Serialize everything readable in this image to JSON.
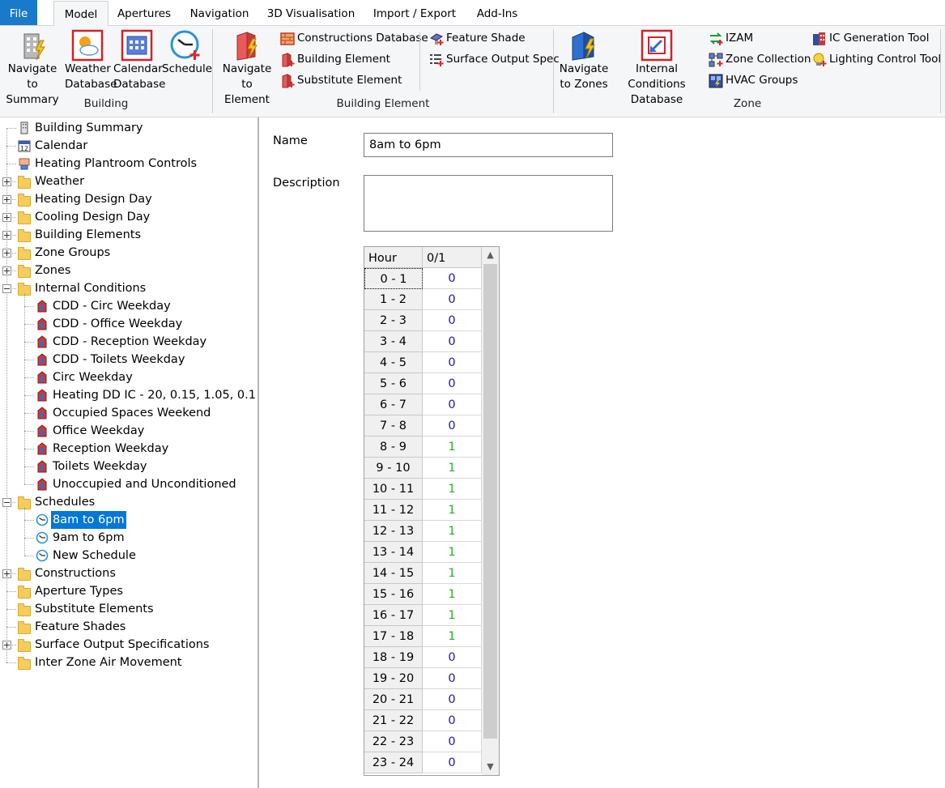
{
  "tabs": [
    "File",
    "Model",
    "Apertures",
    "Navigation",
    "3D Visualisation",
    "Import / Export",
    "Add-Ins"
  ],
  "ribbon": {
    "building": {
      "group_label": "Building",
      "nav_summary": [
        "Navigate to",
        "Summary"
      ],
      "weather_db": [
        "Weather",
        "Database"
      ],
      "calendar_db": [
        "Calendar",
        "Database"
      ],
      "schedule": "Schedule"
    },
    "building_element": {
      "group_label": "Building Element",
      "nav_element": [
        "Navigate",
        "to Element"
      ],
      "constructions_db": "Constructions Database",
      "building_element": "Building Element",
      "substitute_element": "Substitute Element",
      "feature_shade": "Feature Shade",
      "surface_output_spec": "Surface Output Spec"
    },
    "zone": {
      "group_label": "Zone",
      "nav_zones": [
        "Navigate",
        "to Zones"
      ],
      "ic_db": [
        "Internal Conditions",
        "Database"
      ],
      "izam": "IZAM",
      "zone_collection": "Zone Collection",
      "hvac_groups": "HVAC Groups",
      "ic_generation_tool": "IC Generation Tool",
      "lighting_control_tool": "Lighting Control Tool"
    }
  },
  "tree": [
    {
      "label": "Building Summary",
      "icon": "building-icon",
      "level": 0,
      "expander": ""
    },
    {
      "label": "Calendar",
      "icon": "calendar-icon",
      "level": 0,
      "expander": ""
    },
    {
      "label": "Heating Plantroom Controls",
      "icon": "plantroom-icon",
      "level": 0,
      "expander": ""
    },
    {
      "label": "Weather",
      "icon": "folder-icon",
      "level": 0,
      "expander": "plus"
    },
    {
      "label": "Heating Design Day",
      "icon": "folder-icon",
      "level": 0,
      "expander": "plus"
    },
    {
      "label": "Cooling Design Day",
      "icon": "folder-icon",
      "level": 0,
      "expander": "plus"
    },
    {
      "label": "Building Elements",
      "icon": "folder-icon",
      "level": 0,
      "expander": "plus"
    },
    {
      "label": "Zone Groups",
      "icon": "folder-icon",
      "level": 0,
      "expander": "plus"
    },
    {
      "label": "Zones",
      "icon": "folder-icon",
      "level": 0,
      "expander": "plus"
    },
    {
      "label": "Internal Conditions",
      "icon": "folder-icon",
      "level": 0,
      "expander": "minus"
    },
    {
      "label": "CDD - Circ Weekday",
      "icon": "internal-condition-icon",
      "level": 1,
      "expander": ""
    },
    {
      "label": "CDD - Office Weekday",
      "icon": "internal-condition-icon",
      "level": 1,
      "expander": ""
    },
    {
      "label": "CDD - Reception Weekday",
      "icon": "internal-condition-icon",
      "level": 1,
      "expander": ""
    },
    {
      "label": "CDD - Toilets Weekday",
      "icon": "internal-condition-icon",
      "level": 1,
      "expander": ""
    },
    {
      "label": "Circ Weekday",
      "icon": "internal-condition-icon",
      "level": 1,
      "expander": ""
    },
    {
      "label": "Heating DD IC - 20, 0.15, 1.05, 0.1",
      "icon": "internal-condition-icon",
      "level": 1,
      "expander": ""
    },
    {
      "label": "Occupied Spaces Weekend",
      "icon": "internal-condition-icon",
      "level": 1,
      "expander": ""
    },
    {
      "label": "Office Weekday",
      "icon": "internal-condition-icon",
      "level": 1,
      "expander": ""
    },
    {
      "label": "Reception Weekday",
      "icon": "internal-condition-icon",
      "level": 1,
      "expander": ""
    },
    {
      "label": "Toilets Weekday",
      "icon": "internal-condition-icon",
      "level": 1,
      "expander": ""
    },
    {
      "label": "Unoccupied and Unconditioned",
      "icon": "internal-condition-icon",
      "level": 1,
      "expander": ""
    },
    {
      "label": "Schedules",
      "icon": "folder-icon",
      "level": 0,
      "expander": "minus"
    },
    {
      "label": "8am to 6pm",
      "icon": "clock-icon",
      "level": 1,
      "expander": "",
      "selected": true
    },
    {
      "label": "9am to 6pm",
      "icon": "clock-icon",
      "level": 1,
      "expander": ""
    },
    {
      "label": "New Schedule",
      "icon": "clock-icon",
      "level": 1,
      "expander": ""
    },
    {
      "label": "Constructions",
      "icon": "folder-icon",
      "level": 0,
      "expander": "plus"
    },
    {
      "label": "Aperture Types",
      "icon": "folder-icon",
      "level": 0,
      "expander": ""
    },
    {
      "label": "Substitute Elements",
      "icon": "folder-icon",
      "level": 0,
      "expander": ""
    },
    {
      "label": "Feature Shades",
      "icon": "folder-icon",
      "level": 0,
      "expander": ""
    },
    {
      "label": "Surface Output Specifications",
      "icon": "folder-icon",
      "level": 0,
      "expander": "plus"
    },
    {
      "label": "Inter Zone Air Movement",
      "icon": "folder-icon",
      "level": 0,
      "expander": ""
    }
  ],
  "form": {
    "name_label": "Name",
    "name_value": "8am to 6pm",
    "description_label": "Description",
    "description_value": ""
  },
  "grid": {
    "headers": [
      "Hour",
      "0/1"
    ],
    "rows": [
      [
        "0 - 1",
        "0"
      ],
      [
        "1 - 2",
        "0"
      ],
      [
        "2 - 3",
        "0"
      ],
      [
        "3 - 4",
        "0"
      ],
      [
        "4 - 5",
        "0"
      ],
      [
        "5 - 6",
        "0"
      ],
      [
        "6 - 7",
        "0"
      ],
      [
        "7 - 8",
        "0"
      ],
      [
        "8 - 9",
        "1"
      ],
      [
        "9 - 10",
        "1"
      ],
      [
        "10 - 11",
        "1"
      ],
      [
        "11 - 12",
        "1"
      ],
      [
        "12 - 13",
        "1"
      ],
      [
        "13 - 14",
        "1"
      ],
      [
        "14 - 15",
        "1"
      ],
      [
        "15 - 16",
        "1"
      ],
      [
        "16 - 17",
        "1"
      ],
      [
        "17 - 18",
        "1"
      ],
      [
        "18 - 19",
        "0"
      ],
      [
        "19 - 20",
        "0"
      ],
      [
        "20 - 21",
        "0"
      ],
      [
        "21 - 22",
        "0"
      ],
      [
        "22 - 23",
        "0"
      ],
      [
        "23 - 24",
        "0"
      ]
    ],
    "colors": {
      "zero": "#1a1aa6",
      "one": "#22b322"
    }
  }
}
